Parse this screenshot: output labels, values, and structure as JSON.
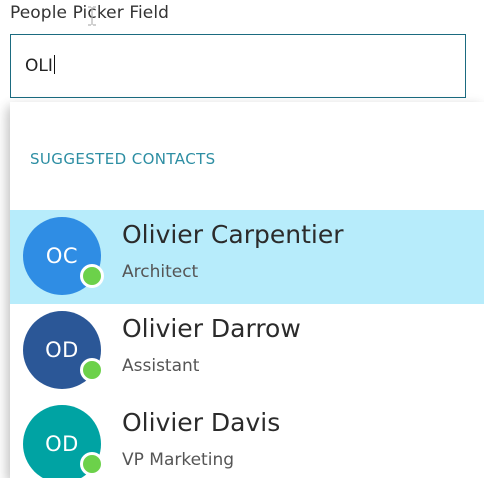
{
  "field": {
    "label": "People Picker Field",
    "value": "OLI"
  },
  "dropdown": {
    "header": "SUGGESTED CONTACTS",
    "contacts": [
      {
        "initials": "OC",
        "name": "Olivier Carpentier",
        "title": "Architect",
        "avatar_color": "#2f8de4",
        "presence": "online",
        "selected": true
      },
      {
        "initials": "OD",
        "name": "Olivier Darrow",
        "title": "Assistant",
        "avatar_color": "#2b5797",
        "presence": "online",
        "selected": false
      },
      {
        "initials": "OD",
        "name": "Olivier Davis",
        "title": "VP Marketing",
        "avatar_color": "#00a3a3",
        "presence": "online",
        "selected": false
      }
    ]
  },
  "colors": {
    "accent": "#2d8ea3",
    "input_border": "#1b6b80",
    "selected_row": "#b7ecfb",
    "presence_online": "#6cd14a"
  }
}
